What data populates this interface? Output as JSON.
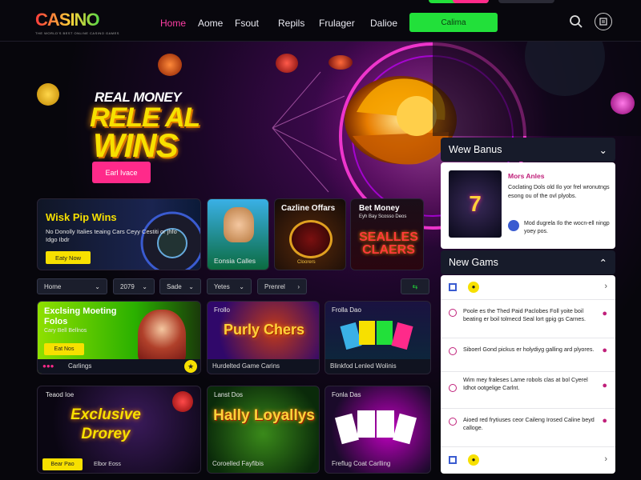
{
  "header": {
    "logo": "CASINO",
    "logo_sub": "THE WORLD'S BEST ONLINE CASINO GAMES",
    "nav": [
      "Home",
      "Aome",
      "Fsout",
      "Repils",
      "Frulager",
      "Dalioe"
    ],
    "cta": "Calima"
  },
  "hero": {
    "line1": "REAL MONEY",
    "line2": "RELE AL",
    "line3": "WINS",
    "button": "Earl Ivace"
  },
  "promo_cards": [
    {
      "title": "Wisk Pip Wins",
      "body": "No Donolly Italies teaing Cars Ceyy Cestiti or jhfo Idgo Ibdr",
      "button": "Eaty Now"
    },
    {
      "title": "",
      "caption": "Eonsia Calles"
    },
    {
      "title": "Cazline Offars",
      "caption": "Cloorers"
    },
    {
      "title": "Bet Money",
      "subtitle": "Eyh Bay Scosso Deos",
      "art": "SEALLES CLAERS"
    }
  ],
  "filters": [
    "Home",
    "2079",
    "Sade",
    "Yetes",
    "Prenrel"
  ],
  "games": [
    {
      "title": "Exclsing Moeting Folos",
      "subtitle": "Cary Bell Bellnos",
      "button": "Eat Nos",
      "caption": "Carlings"
    },
    {
      "title": "Purly Chers",
      "tag": "Frollo",
      "caption": "Hurdelted Game Carins"
    },
    {
      "title": "Frolla Dao",
      "caption": "Blinkfod Lenled Wolinis"
    },
    {
      "title": "Exclusive Drorey",
      "tag": "Teaod Ioe",
      "button": "Bear Pao",
      "caption": "Elbor Eoss"
    },
    {
      "title": "Hally Loyallys",
      "tag": "Lanst Dos",
      "caption": "Coroelled Fayfibis"
    },
    {
      "title": "Fonla Das",
      "caption": "Freflug Coat Carlling"
    }
  ],
  "sidebar": {
    "bonus_header": "Wew Banus",
    "bonus_title": "Mors Anles",
    "bonus_body": "Coclating Dols old Ilo yor frel wronutngs esong ou of the ovl plyobs.",
    "bonus_extra": "Mod dugrela Ilo the wocn-ell ningp yoey pos.",
    "new_header": "New Gams",
    "items": [
      {
        "text": "Poole es the Thed Paid Paclobes Foll yoite boil beating er boil tolmecd Seal lort gpig gs Carnes."
      },
      {
        "text": "Siboerl Gond pickus er holydiyg galling ard plyores."
      },
      {
        "text": "Wim mey fraleses Lame robols clas at bol Cyerel Idhot ootgelige Carlnt.",
        "title": "Wim mey fraleses"
      },
      {
        "text": "Aioed red frytiuses ceor Caileng Irosed Caline beyd calloge."
      }
    ]
  },
  "colors": {
    "accent": "#ff2a8a",
    "cta": "#22e03a",
    "hero_text": "#f7e000"
  }
}
